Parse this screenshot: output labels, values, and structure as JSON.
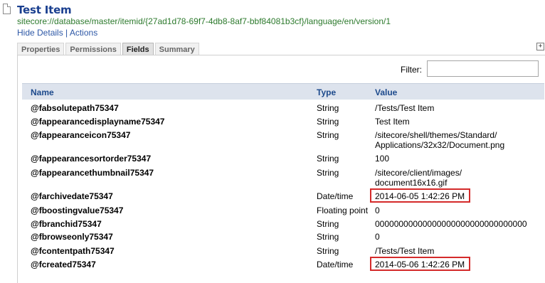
{
  "item": {
    "title": "Test Item",
    "path": "sitecore://database/master/itemid/{27ad1d78-69f7-4db8-8af7-bbf84081b3cf}/language/en/version/1",
    "hide_details": "Hide Details",
    "separator": "|",
    "actions": "Actions"
  },
  "tabs": [
    {
      "label": "Properties"
    },
    {
      "label": "Permissions"
    },
    {
      "label": "Fields"
    },
    {
      "label": "Summary"
    }
  ],
  "active_tab": "Fields",
  "expand_label": "+",
  "filter": {
    "label": "Filter:",
    "value": ""
  },
  "columns": {
    "name": "Name",
    "type": "Type",
    "value": "Value"
  },
  "rows": [
    {
      "name": "@fabsolutepath75347",
      "type": "String",
      "value": "/Tests/Test Item"
    },
    {
      "name": "@fappearancedisplayname75347",
      "type": "String",
      "value": "Test Item"
    },
    {
      "name": "@fappearanceicon75347",
      "type": "String",
      "value": "/sitecore/shell/themes/Standard/\nApplications/32x32/Document.png"
    },
    {
      "name": "@fappearancesortorder75347",
      "type": "String",
      "value": "100"
    },
    {
      "name": "@fappearancethumbnail75347",
      "type": "String",
      "value": "/sitecore/client/images/\ndocument16x16.gif"
    },
    {
      "name": "@farchivedate75347",
      "type": "Date/time",
      "value": "2014-06-05 1:42:26 PM"
    },
    {
      "name": "@fboostingvalue75347",
      "type": "Floating point",
      "value": "0"
    },
    {
      "name": "@fbranchid75347",
      "type": "String",
      "value": "00000000000000000000000000000000"
    },
    {
      "name": "@fbrowseonly75347",
      "type": "String",
      "value": "0"
    },
    {
      "name": "@fcontentpath75347",
      "type": "String",
      "value": "/Tests/Test Item"
    },
    {
      "name": "@fcreated75347",
      "type": "Date/time",
      "value": "2014-05-06 1:42:26 PM"
    }
  ],
  "highlight_color": "#d42a2a"
}
